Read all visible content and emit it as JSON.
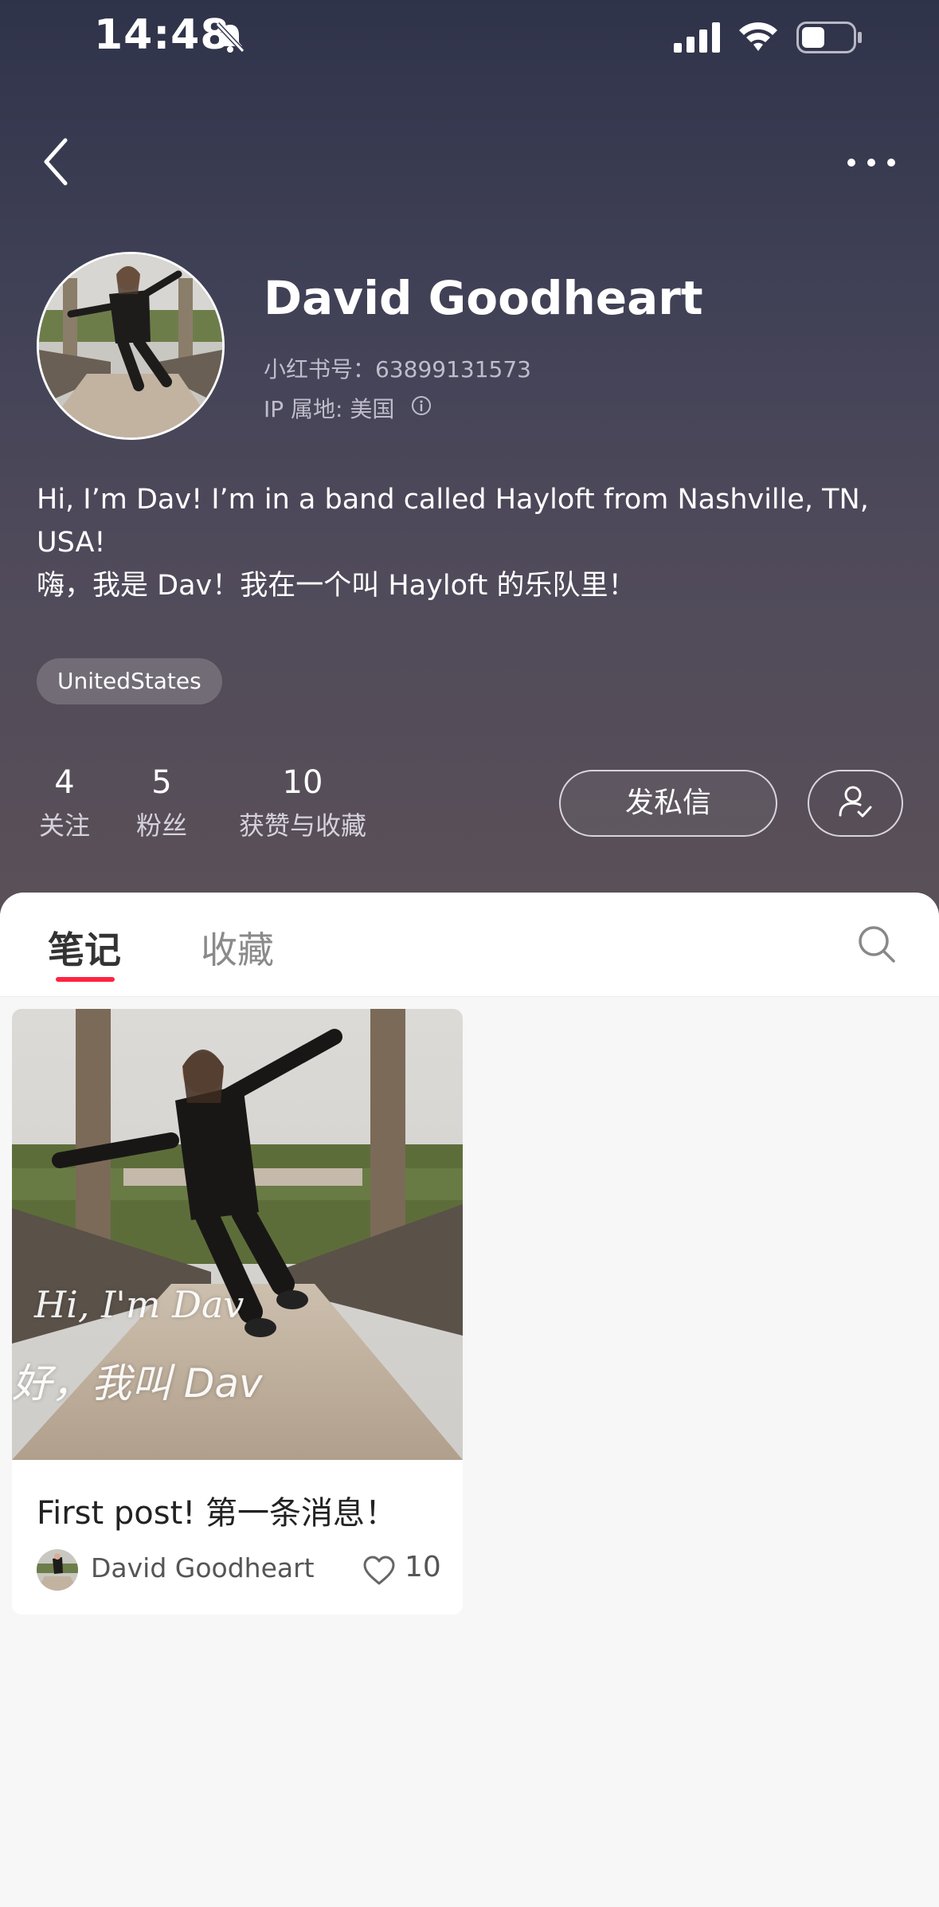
{
  "status_bar": {
    "time": "14:48"
  },
  "profile": {
    "name": "David Goodheart",
    "red_id": "小红书号：63899131573",
    "ip_location": "IP 属地: 美国",
    "bio_lines": [
      "Hi, I’m Dav! I’m in a band called Hayloft from Nashville, TN, USA!",
      "嗨，我是 Dav！我在一个叫 Hayloft 的乐队里！"
    ],
    "tag": "UnitedStates"
  },
  "stats": [
    {
      "value": "4",
      "label": "关注"
    },
    {
      "value": "5",
      "label": "粉丝"
    },
    {
      "value": "10",
      "label": "获赞与收藏"
    }
  ],
  "actions": {
    "message_label": "发私信"
  },
  "tabs": [
    {
      "label": "笔记",
      "active": true
    },
    {
      "label": "收藏",
      "active": false
    }
  ],
  "notes": [
    {
      "overlay_en": "Hi, I'm Dav",
      "overlay_zh": "好，我叫 Dav",
      "title": "First post! 第一条消息！",
      "author": "David Goodheart",
      "likes": "10"
    }
  ],
  "colors": {
    "accent": "#ff2442",
    "header_top": "#2f3349",
    "header_bottom": "#5a5058"
  },
  "icons": [
    "bell-slash-icon",
    "signal-icon",
    "wifi-icon",
    "battery-icon",
    "back-icon",
    "more-icon",
    "info-icon",
    "user-check-icon",
    "search-icon",
    "heart-icon"
  ]
}
